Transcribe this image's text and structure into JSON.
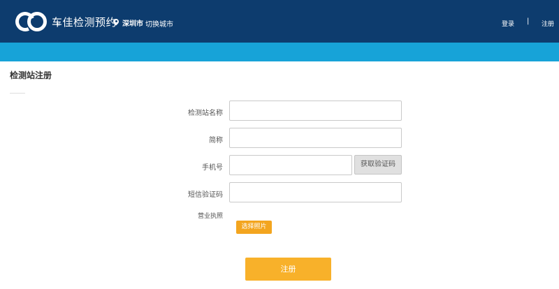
{
  "header": {
    "app_title": "车佳检测预约",
    "reg_mark": "®",
    "city": "深圳市",
    "switch_city": "切换城市",
    "login": "登录",
    "separator": "|",
    "register": "注册"
  },
  "page": {
    "title": "检测站注册"
  },
  "form": {
    "station_name_label": "检测站名称",
    "short_name_label": "简称",
    "phone_label": "手机号",
    "get_code_label": "获取验证码",
    "sms_code_label": "短信验证码",
    "license_label": "营业执照",
    "choose_photo_label": "选择照片",
    "station_name_value": "",
    "short_name_value": "",
    "phone_value": "",
    "sms_code_value": "",
    "submit_label": "注册"
  },
  "colors": {
    "header_bg": "#0d3c6e",
    "band_bg": "#17a3d8",
    "accent_orange": "#f8b12a"
  },
  "icons": {
    "logo": "logo-rings-icon",
    "location": "map-pin-icon"
  }
}
